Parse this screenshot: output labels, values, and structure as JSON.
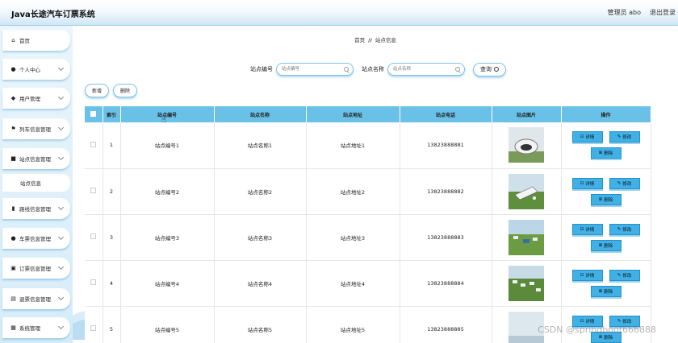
{
  "header": {
    "app_title": "Java长途汽车订票系统",
    "admin_label": "管理员 abo",
    "logout_label": "退出登录"
  },
  "sidebar": {
    "items": [
      {
        "label": "首页",
        "icon": "home-icon",
        "glyph": "⌂",
        "has_chevron": false
      },
      {
        "label": "个人中心",
        "icon": "user-icon",
        "glyph": "●",
        "has_chevron": true
      },
      {
        "label": "用户管理",
        "icon": "users-icon",
        "glyph": "◆",
        "has_chevron": true
      },
      {
        "label": "列车信息管理",
        "icon": "flag-icon",
        "glyph": "⚑",
        "has_chevron": true
      },
      {
        "label": "站点信息管理",
        "icon": "briefcase-icon",
        "glyph": "■",
        "has_chevron": true
      },
      {
        "label": "路线信息管理",
        "icon": "bar-chart-icon",
        "glyph": "▮",
        "has_chevron": true
      },
      {
        "label": "车票信息管理",
        "icon": "pin-icon",
        "glyph": "●",
        "has_chevron": true
      },
      {
        "label": "订票信息管理",
        "icon": "ticket-icon",
        "glyph": "▣",
        "has_chevron": true
      },
      {
        "label": "退票信息管理",
        "icon": "return-icon",
        "glyph": "▤",
        "has_chevron": true
      },
      {
        "label": "系统管理",
        "icon": "grid-icon",
        "glyph": "▦",
        "has_chevron": true
      }
    ],
    "submenu": {
      "label": "站点信息"
    }
  },
  "breadcrumb": {
    "home": "首页",
    "separator": "//",
    "current": "站点信息"
  },
  "search": {
    "field1_label": "站点编号",
    "field1_placeholder": "站点编号",
    "field2_label": "站点名称",
    "field2_placeholder": "站点名称",
    "button_label": "查询"
  },
  "actions": {
    "add_label": "新增",
    "delete_label": "删除"
  },
  "table": {
    "columns": [
      "索引",
      "站点编号",
      "站点名称",
      "站点地址",
      "站点电话",
      "站点图片",
      "操作"
    ],
    "rows": [
      {
        "index": "1",
        "code": "站点编号1",
        "name": "站点名称1",
        "address": "站点地址1",
        "phone": "13823888881"
      },
      {
        "index": "2",
        "code": "站点编号2",
        "name": "站点名称2",
        "address": "站点地址2",
        "phone": "13823888882"
      },
      {
        "index": "3",
        "code": "站点编号3",
        "name": "站点名称3",
        "address": "站点地址3",
        "phone": "13823888883"
      },
      {
        "index": "4",
        "code": "站点编号4",
        "name": "站点名称4",
        "address": "站点地址4",
        "phone": "13823888884"
      },
      {
        "index": "5",
        "code": "站点编号5",
        "name": "站点名称5",
        "address": "站点地址5",
        "phone": "13823888885"
      }
    ],
    "row_ops": {
      "detail": "详情",
      "edit": "修改",
      "delete": "删除"
    }
  },
  "watermark": "CSDN @springboot666888",
  "colors": {
    "header_bg": "#6ac1e8",
    "op_button": "#3fb1e6",
    "accent_border": "#7cc2ea"
  }
}
